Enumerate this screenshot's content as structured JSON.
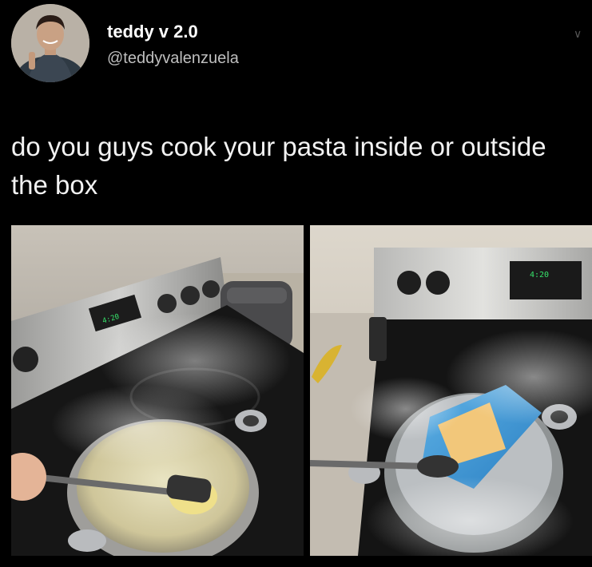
{
  "tweet": {
    "display_name": "teddy v 2.0",
    "handle": "@teddyvalenzuela",
    "text": "do you guys cook your pasta inside or outside the box"
  },
  "icons": {
    "avatar": "profile-photo",
    "menu": "chevron-down-icon"
  },
  "photos": {
    "left_alt": "pasta cooked outside the box in a pot on stove",
    "right_alt": "pasta box boiled inside a pot on stove",
    "stove_display_left": "4:20",
    "stove_display_right": "4:20"
  },
  "colors": {
    "background": "#000000",
    "text": "#ffffff",
    "handle": "#bfbfbf"
  }
}
